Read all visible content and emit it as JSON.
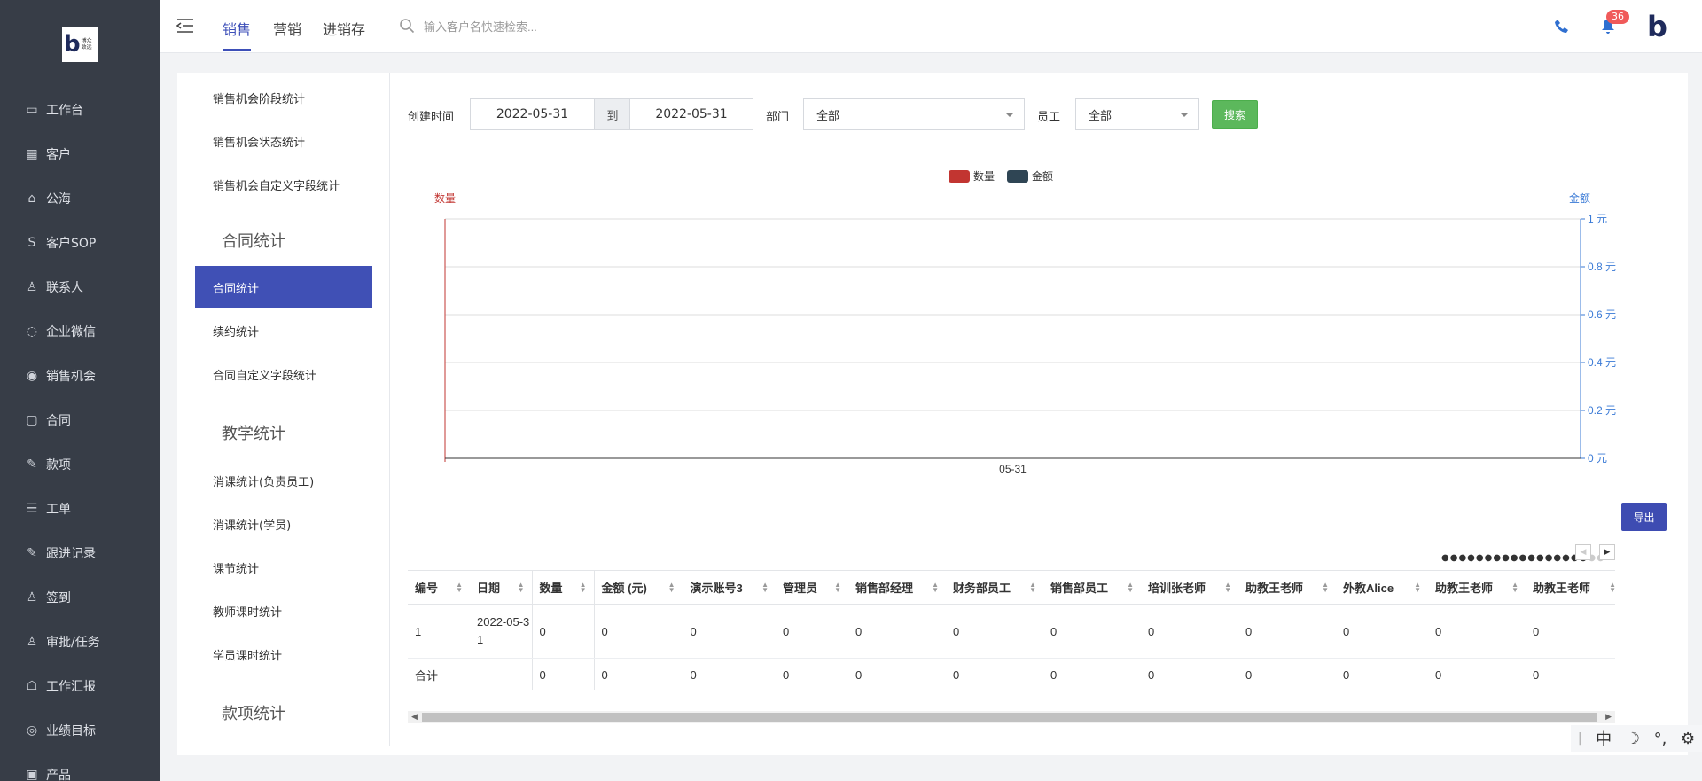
{
  "logo": {
    "text_small": [
      "博众",
      "致远"
    ]
  },
  "sidebar": {
    "items": [
      {
        "label": "工作台",
        "icon": "dashboard-icon"
      },
      {
        "label": "客户",
        "icon": "building-icon"
      },
      {
        "label": "公海",
        "icon": "basket-icon"
      },
      {
        "label": "客户SOP",
        "icon": "sop-icon"
      },
      {
        "label": "联系人",
        "icon": "contact-icon"
      },
      {
        "label": "企业微信",
        "icon": "chat-icon"
      },
      {
        "label": "销售机会",
        "icon": "money-bag-icon"
      },
      {
        "label": "合同",
        "icon": "contract-icon"
      },
      {
        "label": "款项",
        "icon": "payment-icon"
      },
      {
        "label": "工单",
        "icon": "ticket-icon"
      },
      {
        "label": "跟进记录",
        "icon": "edit-icon"
      },
      {
        "label": "签到",
        "icon": "checkin-icon"
      },
      {
        "label": "审批/任务",
        "icon": "approval-icon"
      },
      {
        "label": "工作汇报",
        "icon": "report-icon"
      },
      {
        "label": "业绩目标",
        "icon": "target-icon"
      },
      {
        "label": "产品",
        "icon": "product-icon"
      }
    ]
  },
  "topbar": {
    "tabs": [
      "销售",
      "营销",
      "进销存"
    ],
    "active_tab": "销售",
    "search_placeholder": "输入客户名快速检索...",
    "notification_count": "36"
  },
  "subnav": {
    "items_top": [
      "销售机会阶段统计",
      "销售机会状态统计",
      "销售机会自定义字段统计"
    ],
    "section_contract": "合同统计",
    "contract_items": [
      "合同统计",
      "续约统计",
      "合同自定义字段统计"
    ],
    "active_item": "合同统计",
    "section_teaching": "教学统计",
    "teaching_items": [
      "消课统计(负责员工)",
      "消课统计(学员)",
      "课节统计",
      "教师课时统计",
      "学员课时统计"
    ],
    "section_payment": "款项统计"
  },
  "filters": {
    "created_label": "创建时间",
    "date_from": "2022-05-31",
    "date_sep": "到",
    "date_to": "2022-05-31",
    "dept_label": "部门",
    "dept_value": "全部",
    "staff_label": "员工",
    "staff_value": "全部",
    "search_button": "搜索"
  },
  "chart_data": {
    "type": "bar",
    "categories": [
      "05-31"
    ],
    "series": [
      {
        "name": "数量",
        "values": [
          0
        ],
        "color": "#c23531",
        "axis": "left"
      },
      {
        "name": "金额",
        "values": [
          0
        ],
        "color": "#2f4554",
        "axis": "right"
      }
    ],
    "y_left_label": "数量",
    "y_right_label": "金额",
    "y_right_ticks": [
      "0 元",
      "0.2 元",
      "0.4 元",
      "0.6 元",
      "0.8 元",
      "1 元"
    ],
    "ylim_right": [
      0,
      1
    ],
    "legend_position": "top-center",
    "grid": true
  },
  "export_button": "导出",
  "table": {
    "columns": [
      "编号",
      "日期",
      "数量",
      "金额 (元)",
      "演示账号3",
      "管理员",
      "销售部经理",
      "财务部员工",
      "销售部员工",
      "培训张老师",
      "助教王老师",
      "外教Alice",
      "助教王老师",
      "助教王老师"
    ],
    "rows": [
      [
        "1",
        "2022-05-31",
        "0",
        "0",
        "0",
        "0",
        "0",
        "0",
        "0",
        "0",
        "0",
        "0",
        "0",
        "0"
      ],
      [
        "合计",
        "",
        "0",
        "0",
        "0",
        "0",
        "0",
        "0",
        "0",
        "0",
        "0",
        "0",
        "0",
        "0"
      ]
    ]
  },
  "ime": {
    "mode": "中"
  }
}
